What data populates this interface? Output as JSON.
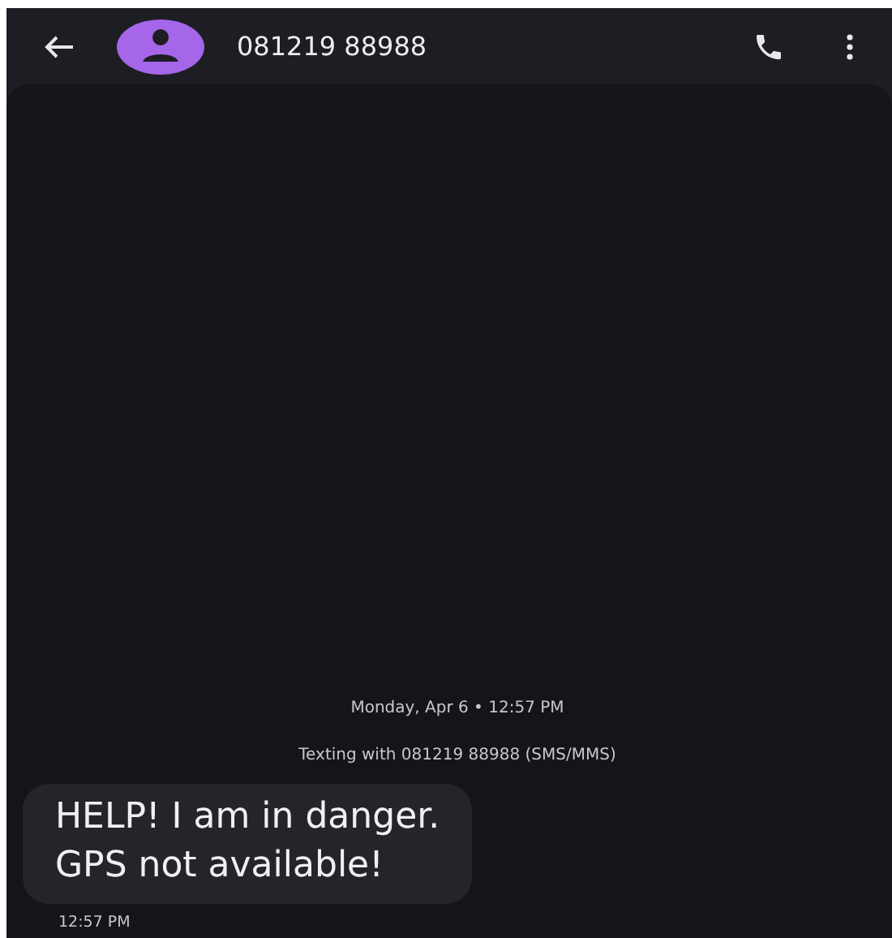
{
  "header": {
    "contact": "081219 88988"
  },
  "conversation": {
    "date": "Monday, Apr 6 • 12:57 PM",
    "info": "Texting with 081219 88988 (SMS/MMS)",
    "messages": [
      {
        "text": "HELP! I am in danger.\nGPS not available!",
        "time": "12:57 PM"
      }
    ]
  }
}
